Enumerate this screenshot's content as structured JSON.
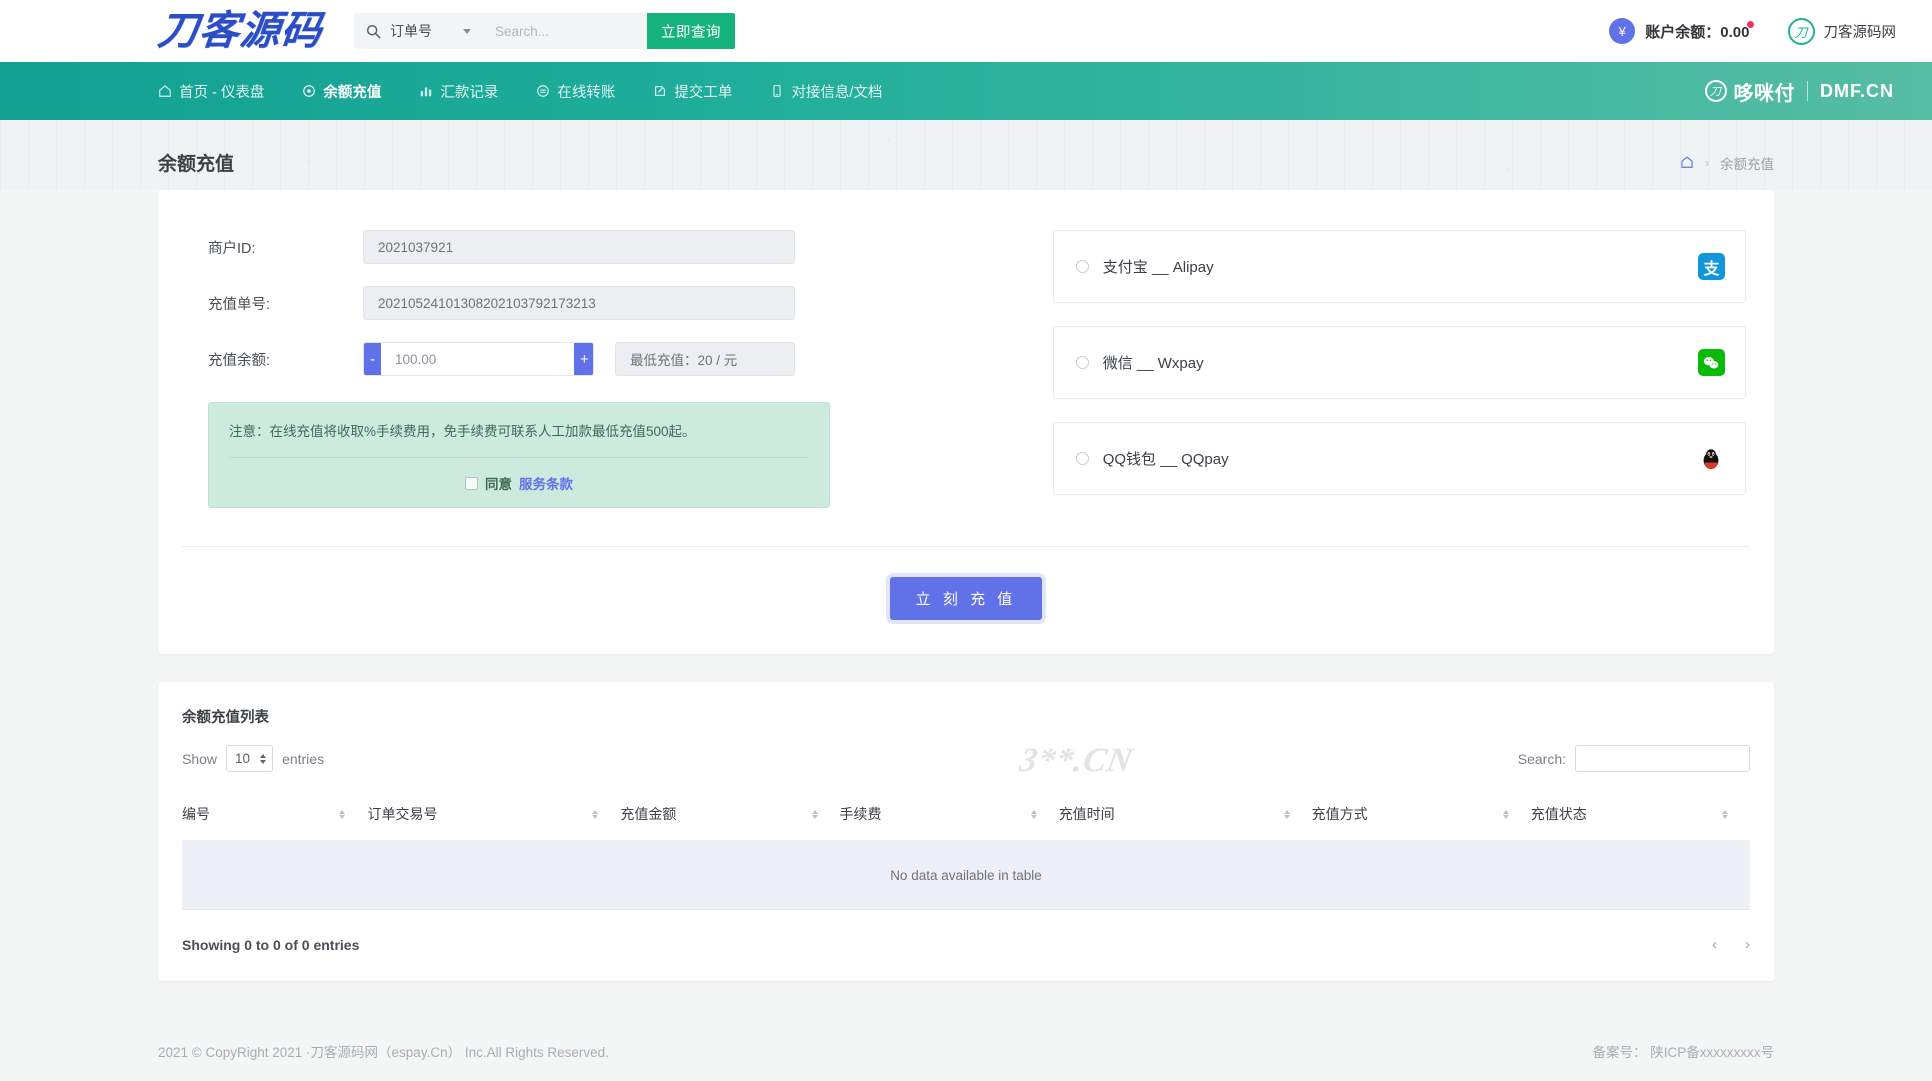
{
  "header": {
    "logo_text": "刀客源码",
    "search": {
      "icon": "search-icon",
      "selected_option": "订单号",
      "options": [
        "订单号"
      ],
      "placeholder": "Search...",
      "button_label": "立即查询"
    },
    "balance": {
      "currency_icon": "¥",
      "label": "账户余额：0.00"
    },
    "account": {
      "logo_letter": "刀",
      "name": "刀客源码网"
    }
  },
  "nav": {
    "items": [
      {
        "icon": "home-icon",
        "label": "首页 - 仪表盘",
        "active": false
      },
      {
        "icon": "wallet-icon",
        "label": "余额充值",
        "active": true
      },
      {
        "icon": "chart-icon",
        "label": "汇款记录",
        "active": false
      },
      {
        "icon": "transfer-icon",
        "label": "在线转账",
        "active": false
      },
      {
        "icon": "ticket-icon",
        "label": "提交工单",
        "active": false
      },
      {
        "icon": "doc-icon",
        "label": "对接信息/文档",
        "active": false
      }
    ],
    "brand": {
      "circle_letter": "刀",
      "cn_name": "哆咪付",
      "domain": "DMF.CN"
    }
  },
  "page": {
    "title": "余额充值",
    "breadcrumb": {
      "home_icon": "home-icon",
      "separator": "›",
      "current": "余额充值"
    }
  },
  "form": {
    "merchant_id": {
      "label": "商户ID:",
      "value": "2021037921"
    },
    "order_no": {
      "label": "充值单号:",
      "value": "20210524101308202103792173213"
    },
    "amount": {
      "label": "充值余额:",
      "minus": "-",
      "plus": "+",
      "value": "100.00",
      "min_note": "最低充值：20 / 元"
    },
    "notice": {
      "text": "注意：在线充值将收取%手续费用，免手续费可联系人工加款最低充值500起。",
      "agree_label": "同意",
      "agree_link": "服务条款"
    },
    "submit_label": "立 刻 充 值"
  },
  "payments": [
    {
      "label": "支付宝 __ Alipay",
      "icon": "alipay-icon",
      "glyph": "支",
      "selected": false
    },
    {
      "label": "微信 __ Wxpay",
      "icon": "wechat-icon",
      "glyph": "微",
      "selected": false
    },
    {
      "label": "QQ钱包 __ QQpay",
      "icon": "qq-icon",
      "glyph": "🐧",
      "selected": false
    }
  ],
  "table": {
    "title": "余额充值列表",
    "show_prefix": "Show",
    "length_value": "10",
    "show_suffix": "entries",
    "search_label": "Search:",
    "search_value": "",
    "columns": [
      "编号",
      "订单交易号",
      "充值金额",
      "手续费",
      "充值时间",
      "充值方式",
      "充值状态"
    ],
    "empty_text": "No data available in table",
    "info": "Showing 0 to 0 of 0 entries",
    "prev": "‹",
    "next": "›",
    "watermark": "3**.CN"
  },
  "footer": {
    "copyright": "2021 © CopyRight 2021 ·刀客源码网（espay.Cn） Inc.All Rights Reserved.",
    "icp": "备案号： 陕ICP备xxxxxxxxx号"
  }
}
